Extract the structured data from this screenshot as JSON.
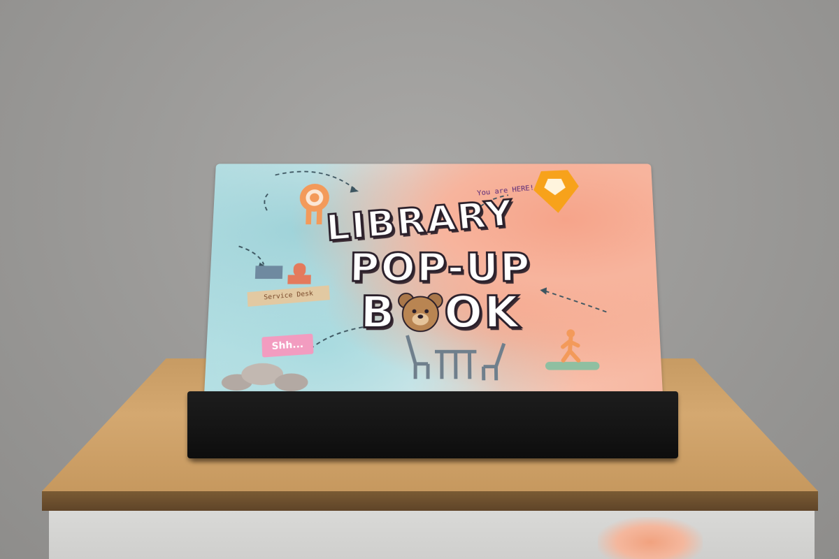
{
  "book": {
    "title_line1": "LIBRARY",
    "title_line2": "POP-UP",
    "title_line3_a": "B",
    "title_line3_b": "OK",
    "you_are_here": "You are HERE!",
    "service_desk": "Service Desk",
    "shh": "Shh..."
  },
  "colors": {
    "wall": "#9a9997",
    "wood": "#d4a870",
    "stand": "#141414",
    "coral": "#f6a48a",
    "aqua": "#9fd3d9",
    "orange_accent": "#f39a5a"
  },
  "icons": [
    "ribbon-award-icon",
    "map-pin-icon",
    "teddy-bear-icon",
    "chairs-table-icon",
    "walking-person-icon"
  ]
}
